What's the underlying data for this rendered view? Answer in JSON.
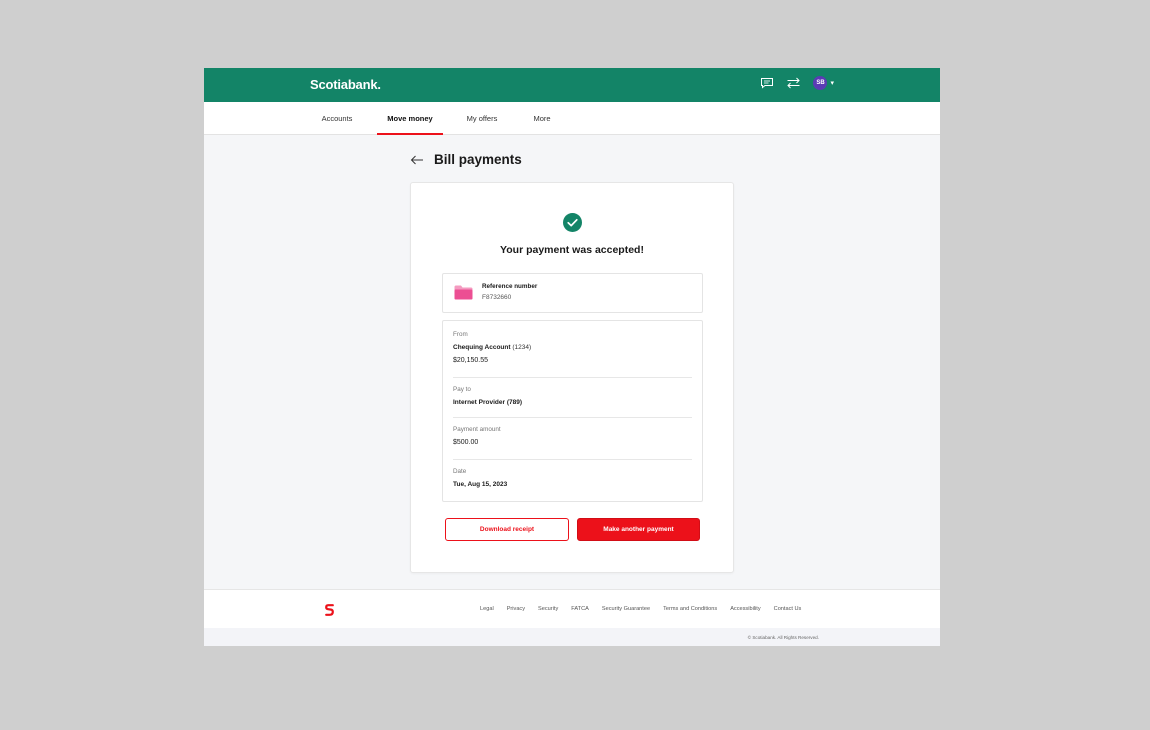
{
  "header": {
    "logo": "Scotiabank.",
    "avatar_initials": "SB",
    "icons": [
      "chat-icon",
      "transfer-icon",
      "chevron-down-icon"
    ],
    "brand_color": "#138467"
  },
  "nav": {
    "items": [
      {
        "label": "Accounts"
      },
      {
        "label": "Move money",
        "active": true
      },
      {
        "label": "My offers"
      },
      {
        "label": "More"
      }
    ],
    "accent_color": "#ec111a"
  },
  "page": {
    "title": "Bill payments"
  },
  "confirmation": {
    "title": "Your payment was accepted!",
    "reference": {
      "label": "Reference number",
      "value": "F8732660"
    },
    "details": {
      "from_label": "From",
      "from_account": "Chequing Account",
      "from_account_number": "(1234)",
      "from_balance": "$20,150.55",
      "pay_to_label": "Pay to",
      "pay_to_value": "Internet Provider (789)",
      "amount_label": "Payment amount",
      "amount_value": "$500.00",
      "date_label": "Date",
      "date_value": "Tue, Aug 15, 2023"
    },
    "buttons": {
      "download": "Download receipt",
      "another": "Make another payment"
    }
  },
  "footer": {
    "links": [
      "Legal",
      "Privacy",
      "Security",
      "FATCA",
      "Security Guarantee",
      "Terms and Conditions",
      "Accessibility",
      "Contact Us"
    ],
    "copyright": "© Scotiabank. All Rights Reserved."
  }
}
